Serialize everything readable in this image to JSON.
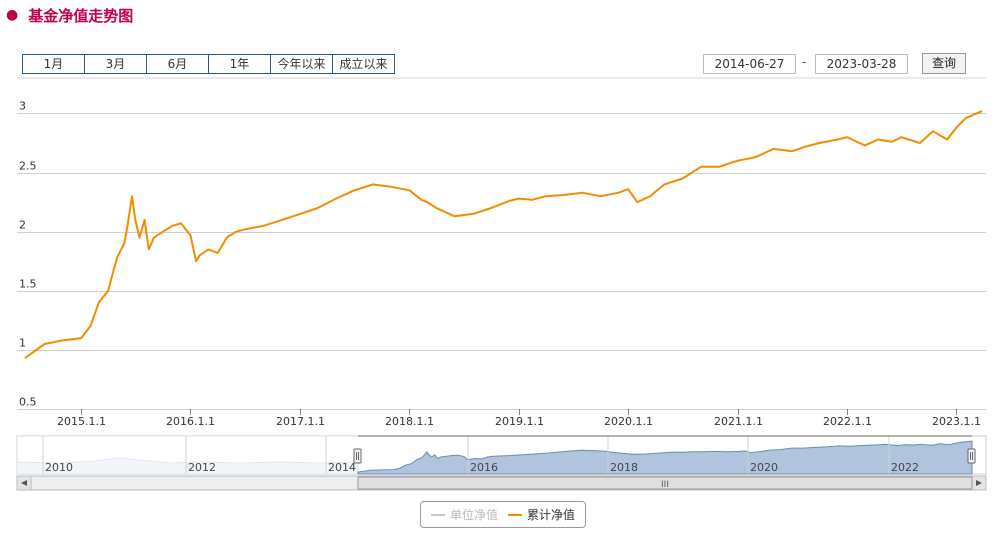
{
  "title": "基金净值走势图",
  "range_buttons": [
    "1月",
    "3月",
    "6月",
    "1年",
    "今年以来",
    "成立以来"
  ],
  "date_from": "2014-06-27",
  "date_sep": "-",
  "date_to": "2023-03-28",
  "query_label": "查询",
  "colors": {
    "title": "#c0004a",
    "main_line": "#f28c00",
    "navigator_fill": "#b0c4de",
    "navigator_line": "#6b8cb8",
    "grid": "#cfcfcf"
  },
  "chart_data": {
    "type": "line",
    "y_ticks": [
      "3",
      "2.5",
      "2",
      "1.5",
      "1",
      "0.5"
    ],
    "x_ticks": [
      "2015.1.1",
      "2016.1.1",
      "2017.1.1",
      "2018.1.1",
      "2019.1.1",
      "2020.1.1",
      "2021.1.1",
      "2022.1.1",
      "2023.1.1"
    ],
    "ylim": [
      0.5,
      3.3
    ],
    "grid": true,
    "series": [
      {
        "name": "累计净值",
        "color": "#f28c00",
        "visible": true,
        "x": [
          "2014-06-27",
          "2014-09-01",
          "2014-11-01",
          "2015-01-01",
          "2015-02-01",
          "2015-03-01",
          "2015-04-01",
          "2015-05-01",
          "2015-05-25",
          "2015-06-05",
          "2015-06-20",
          "2015-07-01",
          "2015-07-15",
          "2015-08-01",
          "2015-08-15",
          "2015-09-01",
          "2015-10-01",
          "2015-11-01",
          "2015-12-01",
          "2016-01-01",
          "2016-01-20",
          "2016-02-01",
          "2016-03-01",
          "2016-04-01",
          "2016-05-01",
          "2016-06-01",
          "2016-07-01",
          "2016-09-01",
          "2016-11-01",
          "2017-01-01",
          "2017-03-01",
          "2017-05-01",
          "2017-07-01",
          "2017-09-01",
          "2017-11-01",
          "2018-01-01",
          "2018-02-10",
          "2018-03-01",
          "2018-04-01",
          "2018-06-01",
          "2018-08-01",
          "2018-10-01",
          "2018-12-01",
          "2019-01-01",
          "2019-02-15",
          "2019-04-01",
          "2019-06-01",
          "2019-08-01",
          "2019-10-01",
          "2019-12-01",
          "2020-01-01",
          "2020-02-01",
          "2020-03-15",
          "2020-05-01",
          "2020-07-01",
          "2020-09-01",
          "2020-11-01",
          "2021-01-01",
          "2021-03-01",
          "2021-05-01",
          "2021-07-01",
          "2021-08-15",
          "2021-10-01",
          "2021-12-01",
          "2022-01-01",
          "2022-03-01",
          "2022-04-15",
          "2022-06-01",
          "2022-07-01",
          "2022-09-01",
          "2022-10-15",
          "2022-12-01",
          "2023-01-01",
          "2023-02-01",
          "2023-03-28"
        ],
        "values": [
          0.93,
          1.05,
          1.08,
          1.1,
          1.2,
          1.4,
          1.5,
          1.78,
          1.9,
          2.05,
          2.3,
          2.1,
          1.95,
          2.1,
          1.85,
          1.95,
          2.0,
          2.05,
          2.07,
          1.97,
          1.75,
          1.8,
          1.85,
          1.82,
          1.95,
          2.0,
          2.02,
          2.05,
          2.1,
          2.15,
          2.2,
          2.28,
          2.35,
          2.4,
          2.38,
          2.35,
          2.27,
          2.25,
          2.2,
          2.13,
          2.15,
          2.2,
          2.26,
          2.28,
          2.27,
          2.3,
          2.31,
          2.33,
          2.3,
          2.33,
          2.36,
          2.25,
          2.3,
          2.4,
          2.45,
          2.55,
          2.55,
          2.6,
          2.63,
          2.7,
          2.68,
          2.72,
          2.75,
          2.78,
          2.8,
          2.73,
          2.78,
          2.76,
          2.8,
          2.75,
          2.85,
          2.78,
          2.88,
          2.96,
          3.02
        ]
      },
      {
        "name": "单位净值",
        "color": "#c8c8c8",
        "visible": false
      }
    ]
  },
  "navigator": {
    "labels": [
      "2010",
      "2012",
      "2014",
      "2016",
      "2018",
      "2020",
      "2022"
    ],
    "scroll_grip": "III"
  },
  "legend": [
    {
      "label": "单位净值",
      "color": "#c8c8c8",
      "active": false
    },
    {
      "label": "累计净值",
      "color": "#f28c00",
      "active": true
    }
  ]
}
